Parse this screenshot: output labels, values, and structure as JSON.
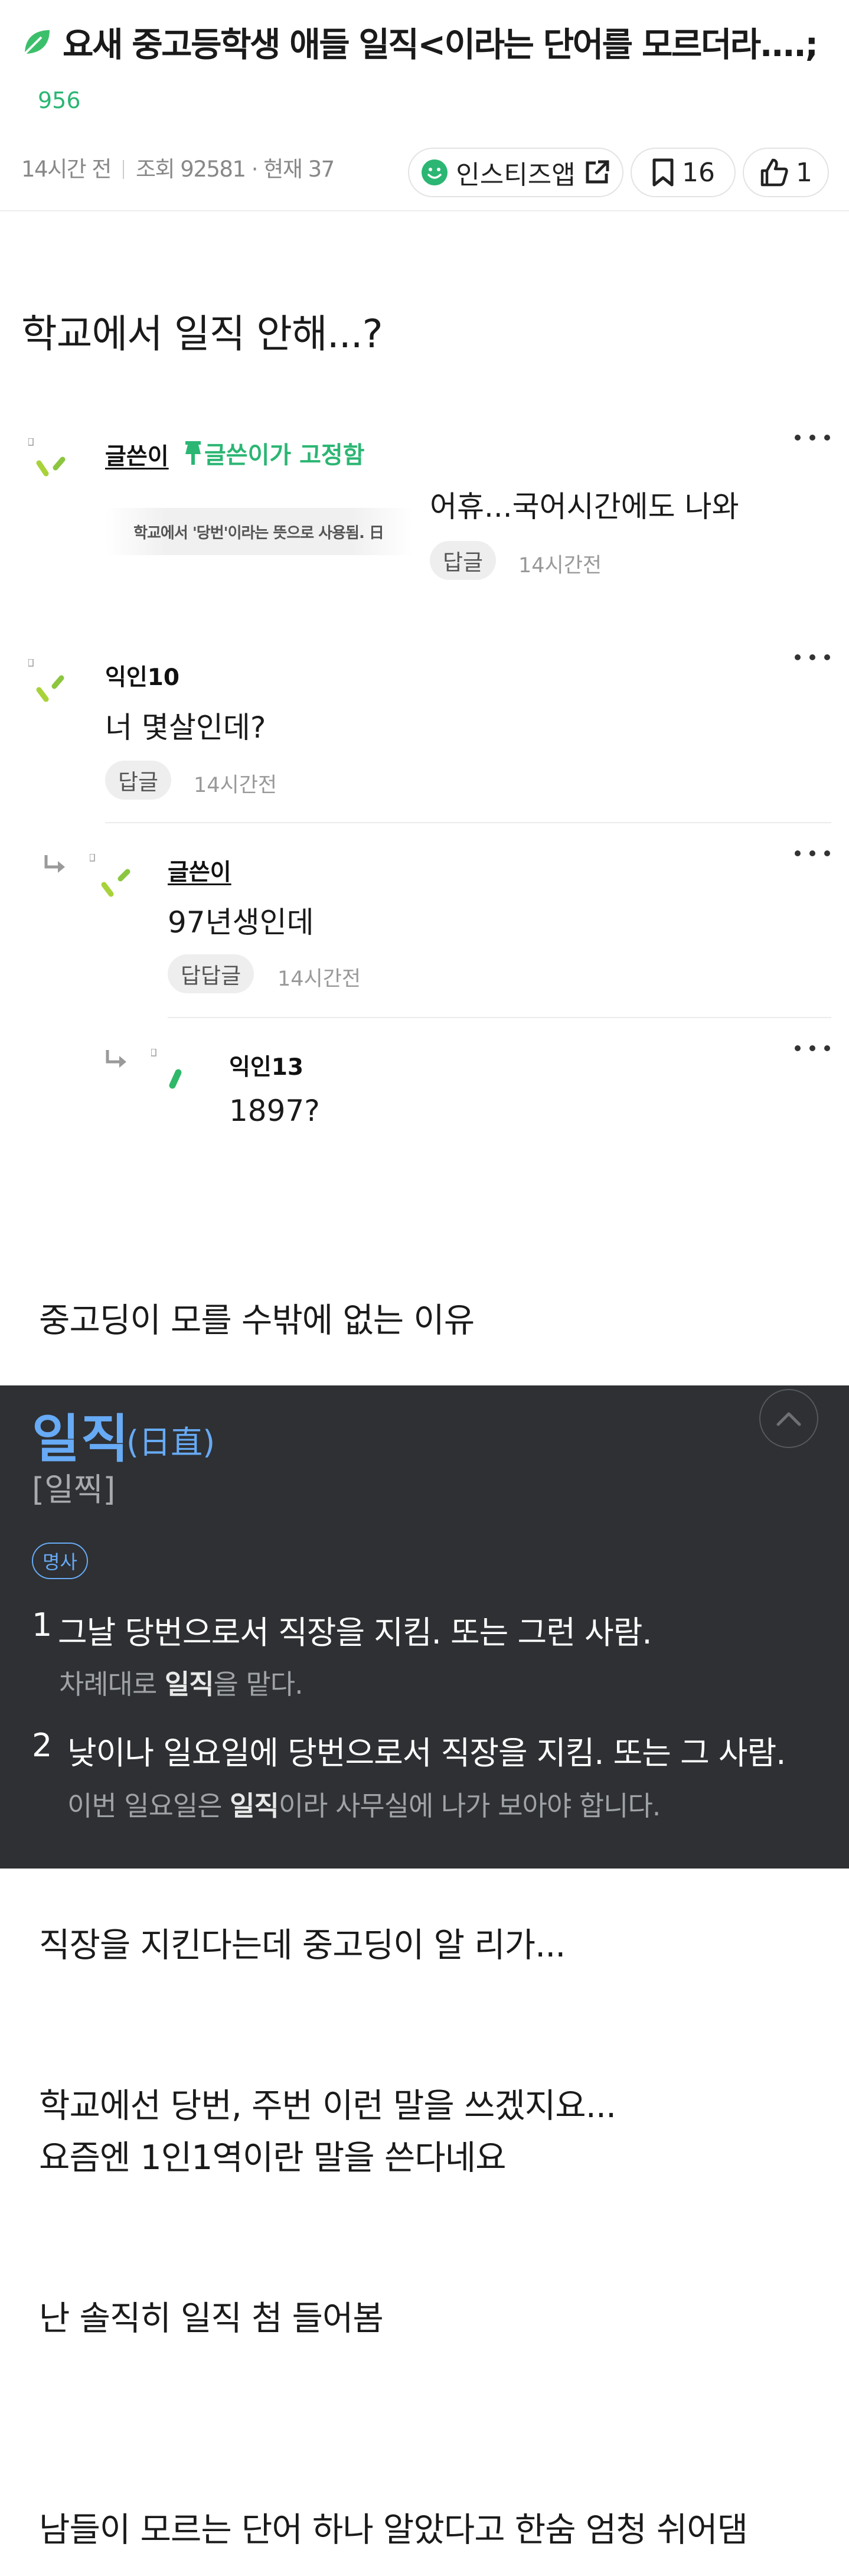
{
  "post": {
    "title": "요새 중고등학생 애들 일직<이라는 단어를 모르더라....;",
    "category_count": "956",
    "time_ago": "14시간 전",
    "views": "조회 92581 · 현재 37",
    "app_label": "인스티즈앱",
    "bookmark_count": "16",
    "like_count": "1"
  },
  "content": {
    "intro": "학교에서 일직 안해...?",
    "reason": "중고딩이 모를 수밖에 없는 이유",
    "line_after_dict": "직장을 지킨다는데 중고딩이 알 리가...",
    "line_school_1": "학교에선 당번, 주번 이런 말을 쓰겠지요...",
    "line_school_2": "요즘엔 1인1역이란 말을 쓴다네요",
    "line_honest": "난 솔직히 일직 첨 들어봄",
    "line_last": "남들이 모르는 단어 하나 알았다고 한숨 엄청 쉬어댐"
  },
  "comments": [
    {
      "name": "글쓴이",
      "pinned": "글쓴이가 고정함",
      "sticker_text": "학교에서 '당번'이라는 뜻으로 사용됨. 日",
      "body": "어휴...국어시간에도 나와",
      "reply_label": "답글",
      "time": "14시간전"
    },
    {
      "name": "익인10",
      "body": "너 몇살인데?",
      "reply_label": "답글",
      "time": "14시간전"
    },
    {
      "name": "글쓴이",
      "body": "97년생인데",
      "reply_label": "답답글",
      "time": "14시간전"
    },
    {
      "name": "익인13",
      "body": "1897?"
    }
  ],
  "dictionary": {
    "word": "일직",
    "hanja": "(日直)",
    "pronunciation": "[일찍]",
    "pos": "명사",
    "defs": [
      {
        "num": "1",
        "text": "그날 당번으로서 직장을 지킴. 또는 그런 사람.",
        "example_pre": "차례대로 ",
        "example_bold": "일직",
        "example_post": "을 맡다."
      },
      {
        "num": "2",
        "text": "낮이나 일요일에 당번으로서 직장을 지킴. 또는 그 사람.",
        "example_pre": "이번 일요일은 ",
        "example_bold": "일직",
        "example_post": "이라 사무실에 나가 보아야 합니다."
      }
    ]
  },
  "colors": {
    "brand_green": "#2bb673",
    "dict_background": "#2e3033",
    "dict_accent": "#67aaf5"
  }
}
